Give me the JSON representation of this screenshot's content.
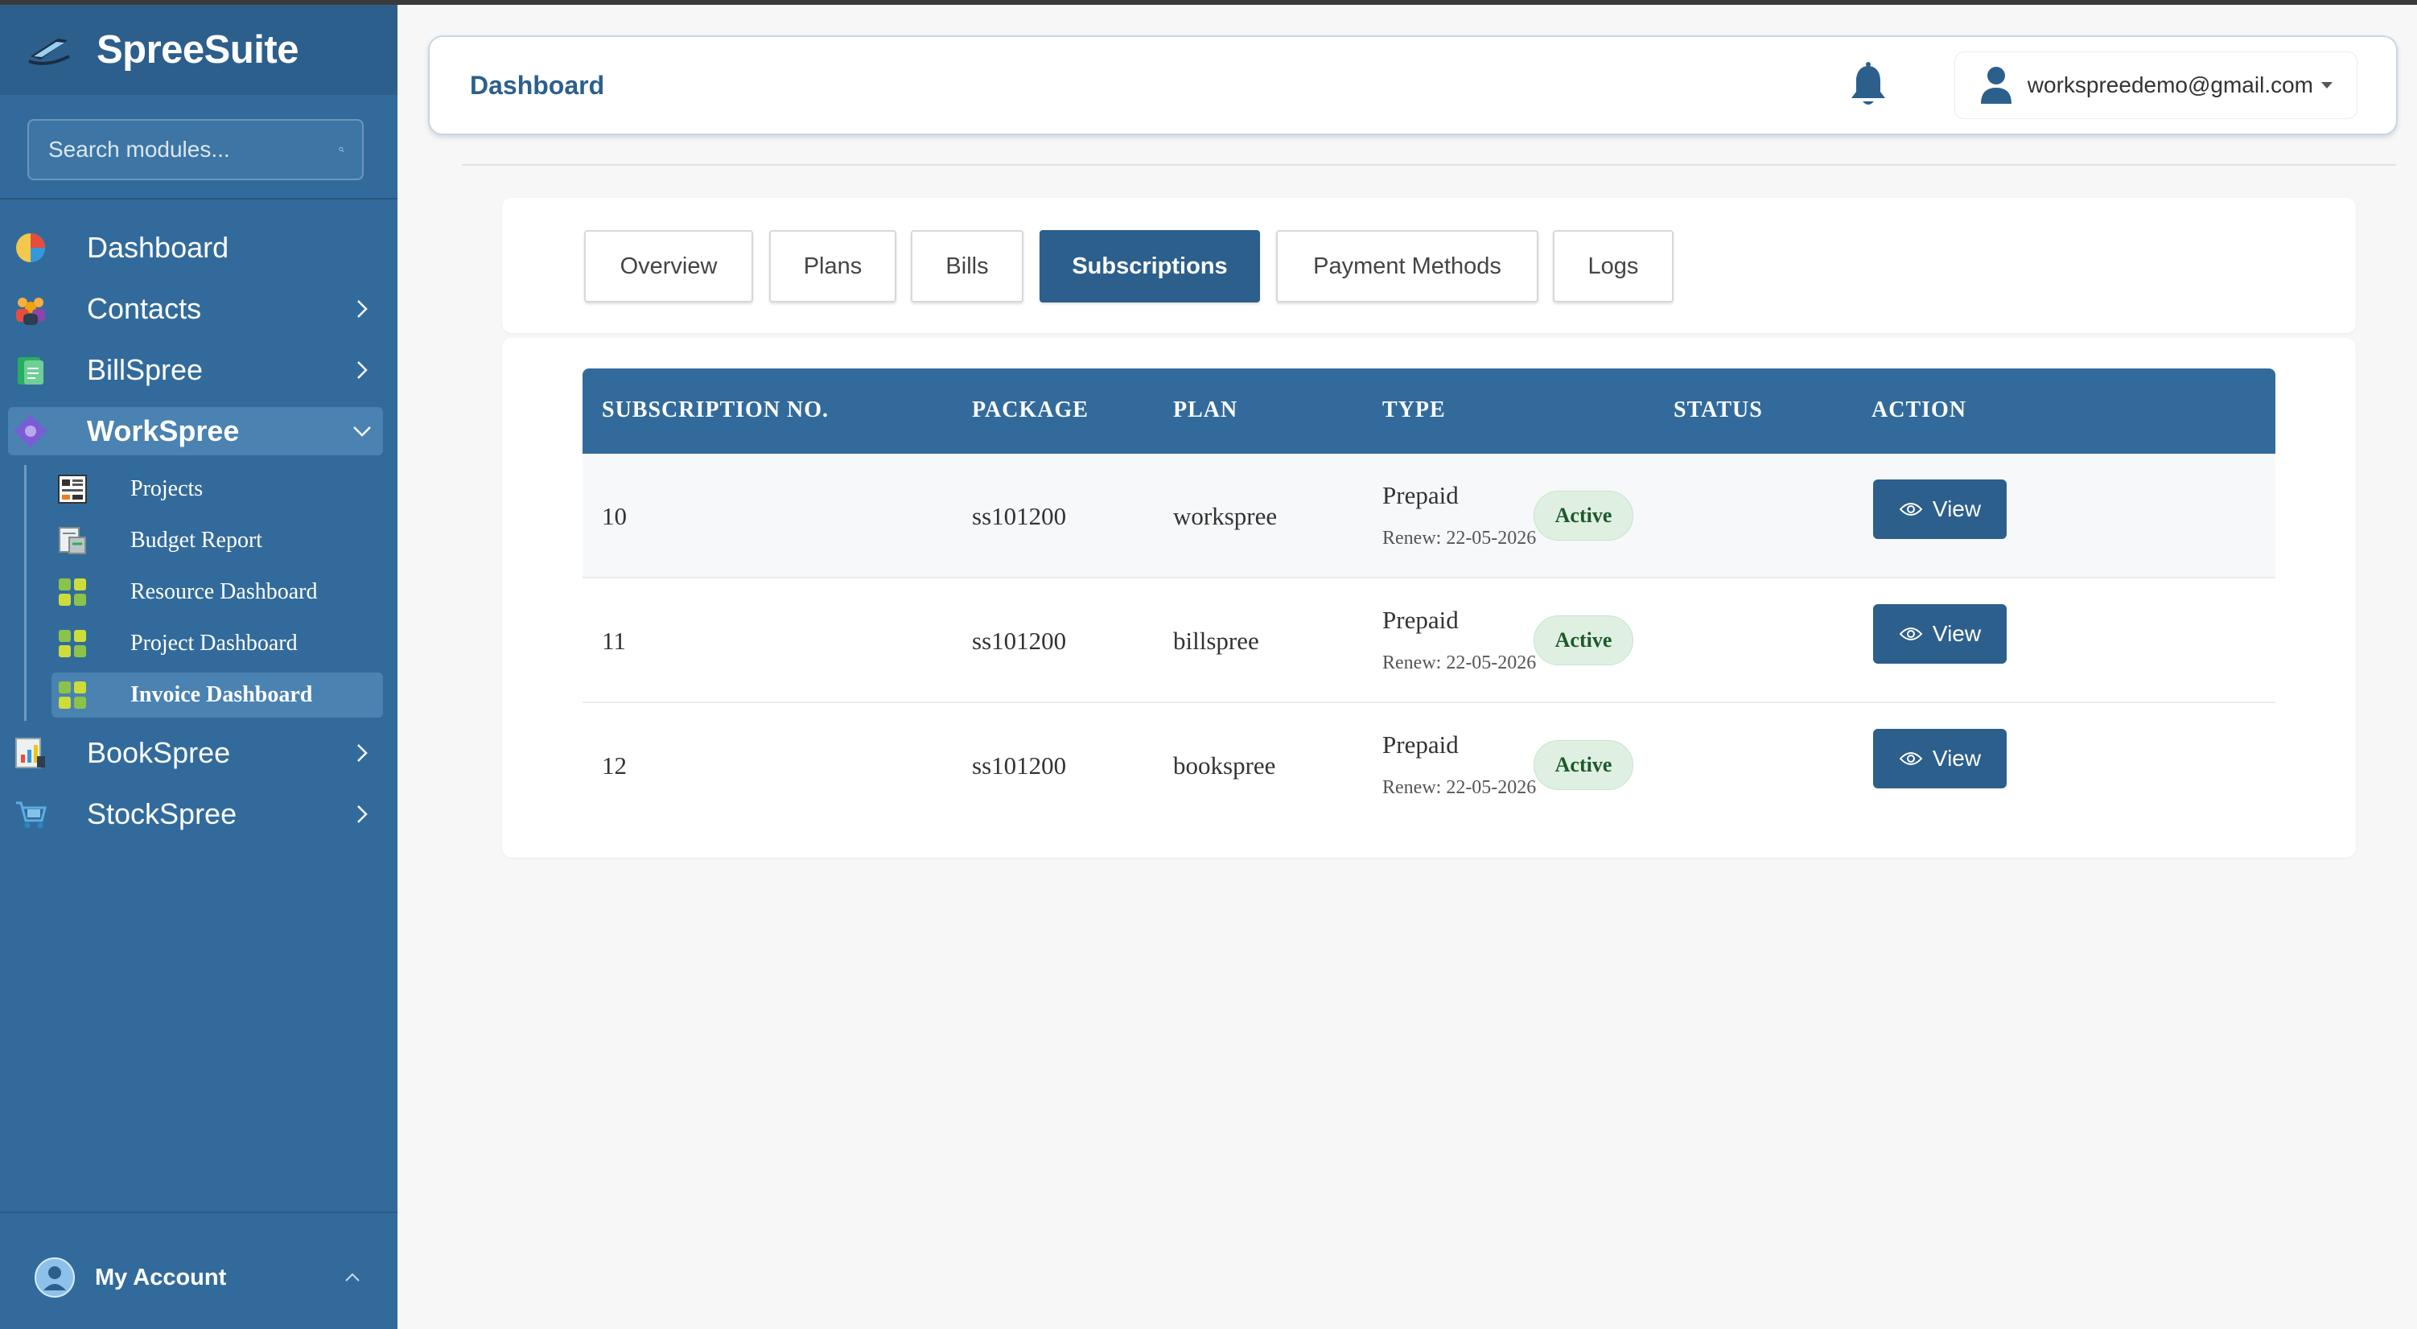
{
  "app": {
    "name": "SpreeSuite"
  },
  "search": {
    "placeholder": "Search modules..."
  },
  "sidebar": {
    "items": [
      {
        "label": "Dashboard"
      },
      {
        "label": "Contacts"
      },
      {
        "label": "BillSpree"
      },
      {
        "label": "WorkSpree"
      },
      {
        "label": "BookSpree"
      },
      {
        "label": "StockSpree"
      }
    ],
    "subitems": [
      {
        "label": "Projects"
      },
      {
        "label": "Budget Report"
      },
      {
        "label": "Resource Dashboard"
      },
      {
        "label": "Project Dashboard"
      },
      {
        "label": "Invoice Dashboard"
      }
    ],
    "account": "My Account"
  },
  "header": {
    "title": "Dashboard",
    "user_email": "workspreedemo@gmail.com"
  },
  "tabs": [
    {
      "label": "Overview"
    },
    {
      "label": "Plans"
    },
    {
      "label": "Bills"
    },
    {
      "label": "Subscriptions"
    },
    {
      "label": "Payment Methods"
    },
    {
      "label": "Logs"
    }
  ],
  "table": {
    "columns": [
      "SUBSCRIPTION NO.",
      "PACKAGE",
      "PLAN",
      "TYPE",
      "STATUS",
      "ACTION"
    ],
    "rows": [
      {
        "no": "10",
        "package": "ss101200",
        "plan": "workspree",
        "type": "Prepaid",
        "renew": "Renew: 22-05-2026",
        "status": "Active",
        "action": "View"
      },
      {
        "no": "11",
        "package": "ss101200",
        "plan": "billspree",
        "type": "Prepaid",
        "renew": "Renew: 22-05-2026",
        "status": "Active",
        "action": "View"
      },
      {
        "no": "12",
        "package": "ss101200",
        "plan": "bookspree",
        "type": "Prepaid",
        "renew": "Renew: 22-05-2026",
        "status": "Active",
        "action": "View"
      }
    ]
  },
  "colors": {
    "primary": "#326b9b",
    "dark": "#2c5f8c",
    "active_badge": "#dff0e2"
  }
}
